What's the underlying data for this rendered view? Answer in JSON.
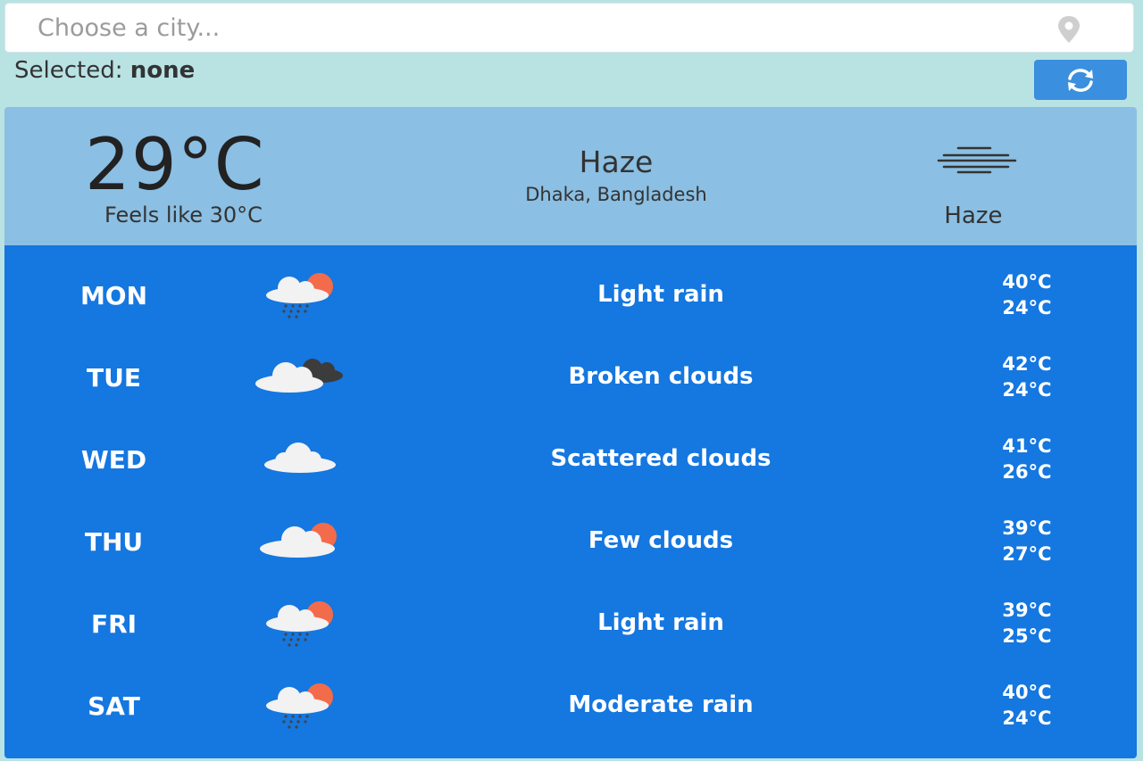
{
  "search": {
    "placeholder": "Choose a city...",
    "pin_icon": "map-pin-icon"
  },
  "selection": {
    "label": "Selected:",
    "value": "none"
  },
  "refresh": {
    "icon": "refresh-icon",
    "color": "#3a8fde"
  },
  "current": {
    "temperature": "29°C",
    "feels_like": "Feels like 30°C",
    "condition": "Haze",
    "location": "Dhaka, Bangladesh",
    "icon": "haze-icon",
    "icon_label": "Haze",
    "background": "#8bbfe3"
  },
  "forecast": {
    "background": "#1577e0",
    "days": [
      {
        "day": "MON",
        "icon": "light-rain-icon",
        "description": "Light rain",
        "high": "40°C",
        "low": "24°C"
      },
      {
        "day": "TUE",
        "icon": "broken-clouds-icon",
        "description": "Broken clouds",
        "high": "42°C",
        "low": "24°C"
      },
      {
        "day": "WED",
        "icon": "scattered-clouds-icon",
        "description": "Scattered clouds",
        "high": "41°C",
        "low": "26°C"
      },
      {
        "day": "THU",
        "icon": "few-clouds-icon",
        "description": "Few clouds",
        "high": "39°C",
        "low": "27°C"
      },
      {
        "day": "FRI",
        "icon": "light-rain-icon",
        "description": "Light rain",
        "high": "39°C",
        "low": "25°C"
      },
      {
        "day": "SAT",
        "icon": "moderate-rain-icon",
        "description": "Moderate rain",
        "high": "40°C",
        "low": "24°C"
      }
    ]
  }
}
